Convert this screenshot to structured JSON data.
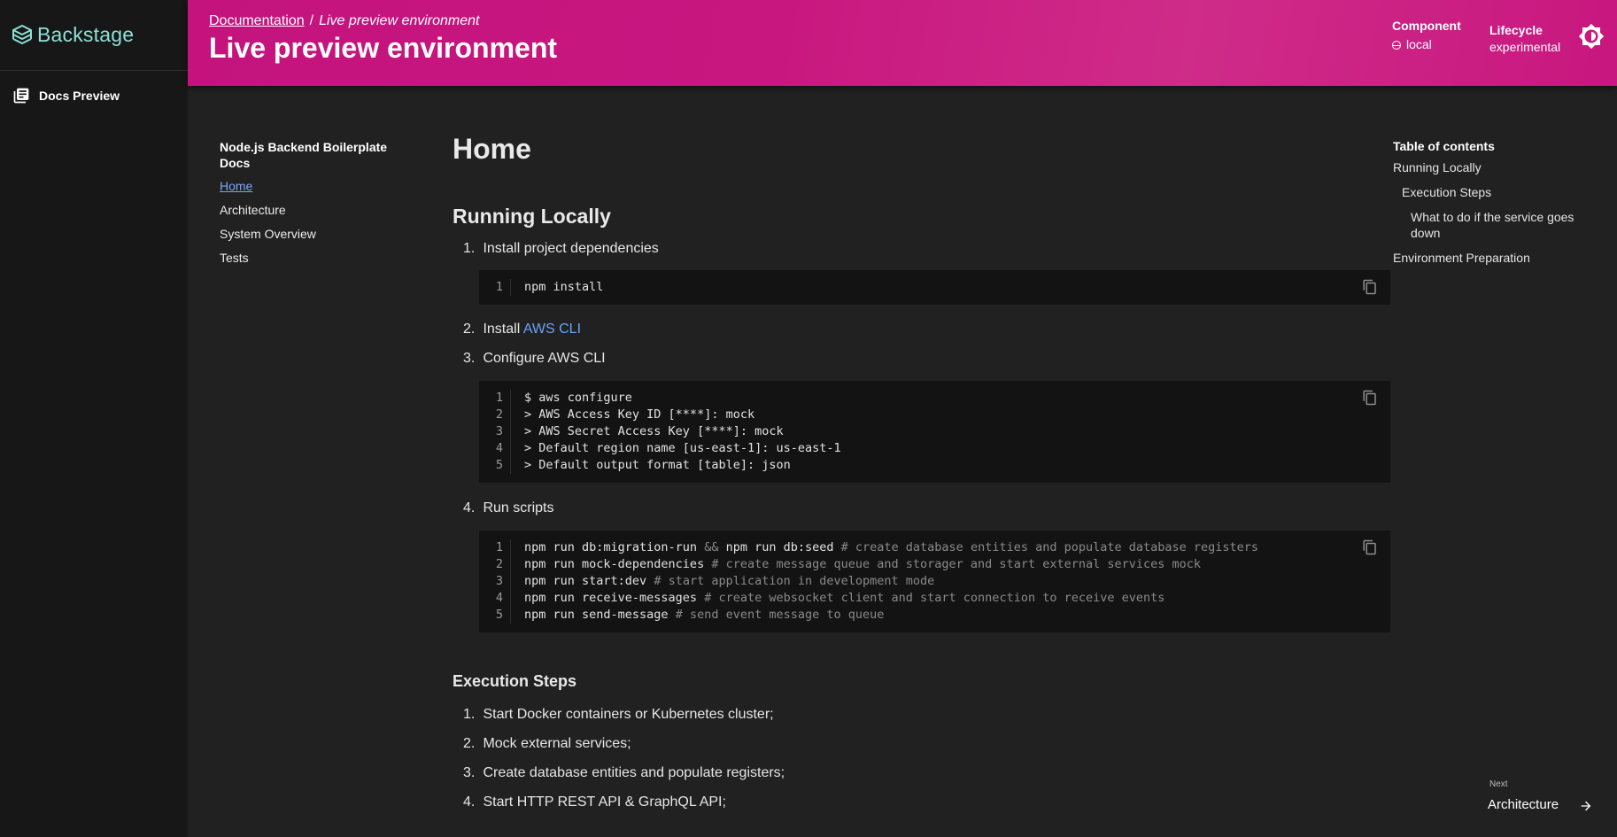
{
  "app": {
    "brand": "Backstage"
  },
  "sidebar": {
    "items": [
      {
        "label": "Docs Preview",
        "icon": "library-books-icon"
      }
    ]
  },
  "header": {
    "breadcrumb": {
      "link": "Documentation",
      "separator": "/",
      "current": "Live preview environment"
    },
    "title": "Live preview environment",
    "component": {
      "label": "Component",
      "value": "local"
    },
    "lifecycle": {
      "label": "Lifecycle",
      "value": "experimental"
    },
    "accent": "#c8177f"
  },
  "docnav": {
    "title": "Node.js Backend Boilerplate Docs",
    "items": [
      "Home",
      "Architecture",
      "System Overview",
      "Tests"
    ]
  },
  "content": {
    "h1": "Home",
    "h2": "Running Locally",
    "steps": [
      {
        "num": "1.",
        "text": "Install project dependencies"
      },
      {
        "num": "2.",
        "text": "Install ",
        "link": "AWS CLI"
      },
      {
        "num": "3.",
        "text": "Configure AWS CLI"
      },
      {
        "num": "4.",
        "text": "Run scripts"
      }
    ],
    "code1": [
      {
        "n": "1",
        "text": "npm install"
      }
    ],
    "code2": [
      {
        "n": "1",
        "text": "$ aws configure"
      },
      {
        "n": "2",
        "text": "> AWS Access Key ID [****]: mock"
      },
      {
        "n": "3",
        "text": "> AWS Secret Access Key [****]: mock"
      },
      {
        "n": "4",
        "text": "> Default region name [us-east-1]: us-east-1"
      },
      {
        "n": "5",
        "text": "> Default output format [table]: json"
      }
    ],
    "code3": [
      {
        "n": "1",
        "cmd": "npm run db:migration-run ",
        "op": "&&",
        "cmd2": " npm run db:seed ",
        "comment": "# create database entities and populate database registers"
      },
      {
        "n": "2",
        "cmd": "npm run mock-dependencies ",
        "comment": "# create message queue and storager and start external services mock"
      },
      {
        "n": "3",
        "cmd": "npm run start:dev ",
        "comment": "# start application in development mode"
      },
      {
        "n": "4",
        "cmd": "npm run receive-messages ",
        "comment": "# create websocket client and start connection to receive events"
      },
      {
        "n": "5",
        "cmd": "npm run send-message ",
        "comment": "# send event message to queue"
      }
    ],
    "h3": "Execution Steps",
    "exec_steps": [
      {
        "num": "1.",
        "text": "Start Docker containers or Kubernetes cluster;"
      },
      {
        "num": "2.",
        "text": "Mock external services;"
      },
      {
        "num": "3.",
        "text": "Create database entities and populate registers;"
      },
      {
        "num": "4.",
        "text": "Start HTTP REST API & GraphQL API;"
      }
    ]
  },
  "toc": {
    "title": "Table of contents",
    "items": [
      "Running Locally",
      "Execution Steps",
      "What to do if the service goes down",
      "Environment Preparation"
    ]
  },
  "footer_nav": {
    "label": "Next",
    "title": "Architecture"
  }
}
